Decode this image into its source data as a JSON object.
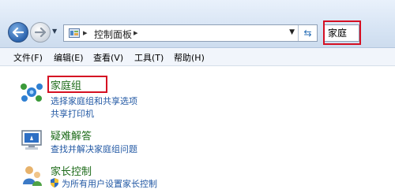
{
  "nav": {
    "back_icon": "back-arrow-icon",
    "forward_icon": "forward-arrow-icon",
    "history_icon": "history-dropdown-icon",
    "address": {
      "folder_icon": "control-panel-icon",
      "separator": "▸",
      "crumb": "控制面板",
      "dropdown_icon": "chevron-down-icon",
      "refresh_icon": "refresh-icon"
    },
    "search": {
      "value": "家庭"
    }
  },
  "menu": {
    "items": [
      "文件(F)",
      "编辑(E)",
      "查看(V)",
      "工具(T)",
      "帮助(H)"
    ]
  },
  "categories": [
    {
      "title": "家庭组",
      "icon": "homegroup-icon",
      "links": [
        "选择家庭组和共享选项",
        "共享打印机"
      ]
    },
    {
      "title": "疑难解答",
      "icon": "troubleshooting-icon",
      "links": [
        "查找并解决家庭组问题"
      ]
    },
    {
      "title": "家长控制",
      "icon": "parental-controls-icon",
      "links": [
        "为所有用户设置家长控制"
      ],
      "link_icon": "uac-shield-icon"
    }
  ],
  "colors": {
    "highlight": "#d51023",
    "title_green": "#1f6c1b",
    "link_blue": "#2359a4"
  }
}
